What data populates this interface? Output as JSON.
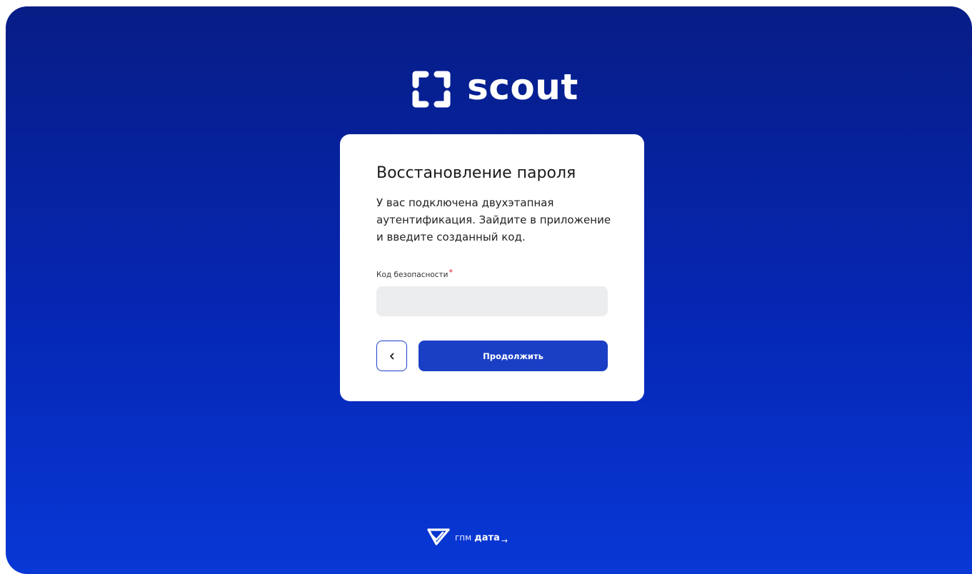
{
  "brand": {
    "name": "scout",
    "logo_icon": "bracket-frame-icon"
  },
  "card": {
    "title": "Восстановление пароля",
    "description": "У вас подключена двухэтапная аутентификация. Зайдите в приложение и введите созданный код.",
    "field": {
      "label": "Код безопасности",
      "required_mark": "*",
      "value": "",
      "placeholder": ""
    },
    "back_button_icon": "chevron-left-icon",
    "continue_label": "Продолжить"
  },
  "footer": {
    "logo_icon": "triangle-check-icon",
    "text_light": "гпм",
    "text_bold": "дата",
    "arrow": "→"
  },
  "colors": {
    "background_top": "#071d86",
    "background_bottom": "#0838d6",
    "primary_button": "#1a3fc4",
    "input_background": "#ebedef",
    "required_mark": "#e0162b"
  }
}
